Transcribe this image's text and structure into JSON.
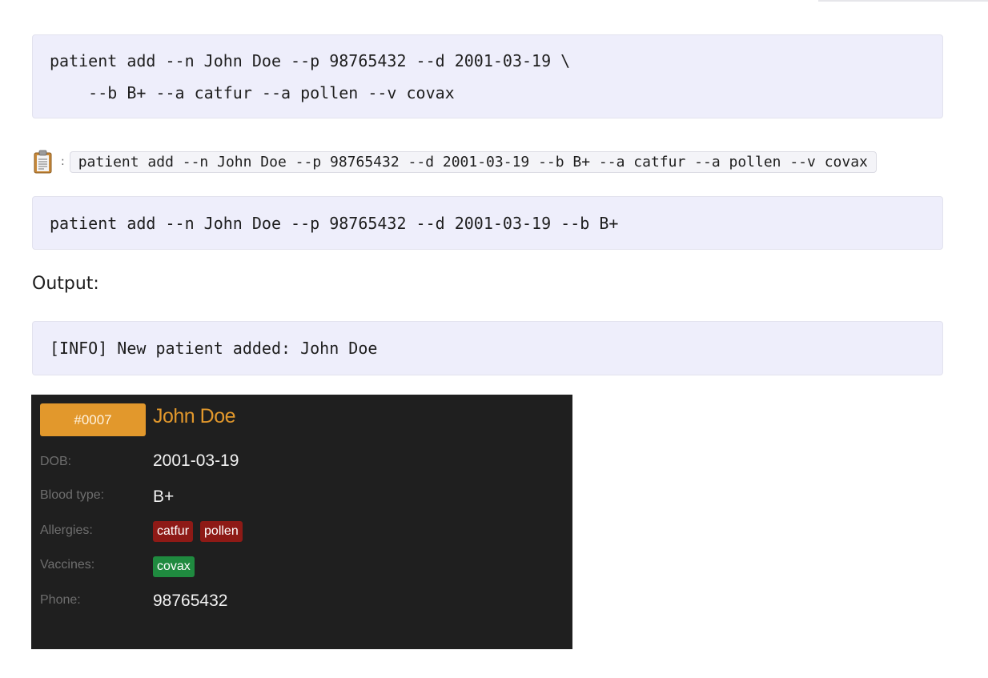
{
  "code_block_1": {
    "line_1": "patient add --n John Doe --p 98765432 --d 2001-03-19 \\",
    "line_2": "    --b B+ --a catfur --a pollen --v covax"
  },
  "copy_line": {
    "icon": "clipboard-icon",
    "separator": ":",
    "command": "patient add --n John Doe --p 98765432 --d 2001-03-19 --b B+ --a catfur --a pollen --v covax"
  },
  "code_block_2": {
    "line_1": "patient add --n John Doe --p 98765432 --d 2001-03-19 --b B+"
  },
  "output_label": "Output:",
  "code_block_3": {
    "line_1": "[INFO] New patient added: John Doe"
  },
  "patient_card": {
    "id": "#0007",
    "name": "John Doe",
    "fields": {
      "dob_label": "DOB:",
      "dob_value": "2001-03-19",
      "blood_label": "Blood type:",
      "blood_value": "B+",
      "allergies_label": "Allergies:",
      "allergies": [
        "catfur",
        "pollen"
      ],
      "vaccines_label": "Vaccines:",
      "vaccines": [
        "covax"
      ],
      "phone_label": "Phone:",
      "phone_value": "98765432"
    },
    "colors": {
      "accent": "#e2982c",
      "background": "#1f1f1f",
      "allergy_tag": "#8e1a16",
      "vaccine_tag": "#1f8a3f"
    }
  }
}
